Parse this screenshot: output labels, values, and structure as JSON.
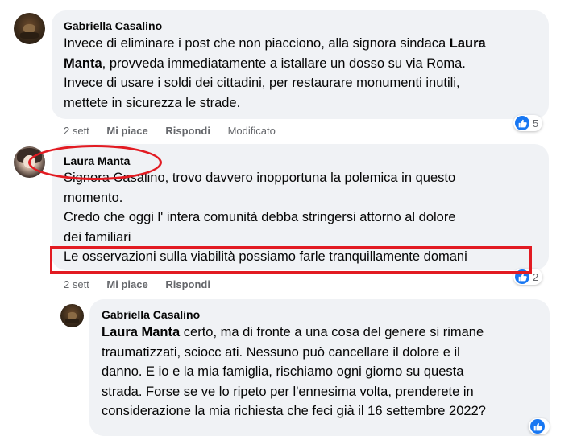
{
  "comments": [
    {
      "author": "Gabriella Casalino",
      "lines": [
        [
          "Invece di eliminare i post che non piacciono, alla signora sindaca ",
          {
            "mention": "Laura"
          }
        ],
        [
          {
            "mention": "Manta"
          },
          ", provveda immediatamente a istallare un dosso su via Roma."
        ],
        [
          "Invece di usare i soldi dei cittadini, per restaurare monumenti inutili,"
        ],
        [
          "mettete in sicurezza le strade."
        ]
      ],
      "time": "2 sett",
      "like_label": "Mi piace",
      "reply_label": "Rispondi",
      "edited_label": "Modificato",
      "reaction_count": "5"
    },
    {
      "author": "Laura Manta",
      "lines": [
        [
          "Signora Casalino, trovo davvero inopportuna la polemica in questo"
        ],
        [
          "momento."
        ],
        [
          "Credo che oggi l' intera comunità debba stringersi attorno al dolore"
        ],
        [
          "dei familiari"
        ],
        [
          "Le osservazioni sulla viabilità possiamo farle tranquillamente domani"
        ]
      ],
      "time": "2 sett",
      "like_label": "Mi piace",
      "reply_label": "Rispondi",
      "reaction_count": "2"
    },
    {
      "author": "Gabriella Casalino",
      "lines": [
        [
          {
            "mention": "Laura Manta"
          },
          " certo, ma di fronte a una cosa del genere si rimane"
        ],
        [
          "traumatizzati, sciocc ati. Nessuno può cancellare il dolore e il"
        ],
        [
          "danno. E io e la mia famiglia, rischiamo ogni giorno su questa"
        ],
        [
          "strada. Forse se ve lo ripeto per l'ennesima volta, prenderete in"
        ],
        [
          "considerazione la mia richiesta che feci già il 16 settembre 2022?"
        ]
      ]
    }
  ],
  "colors": {
    "bubble": "#f0f2f5",
    "meta": "#65676b",
    "like_blue": "#1877f2",
    "annotation_red": "#e21b22"
  },
  "icons": [
    "avatar",
    "like-thumb-icon"
  ]
}
